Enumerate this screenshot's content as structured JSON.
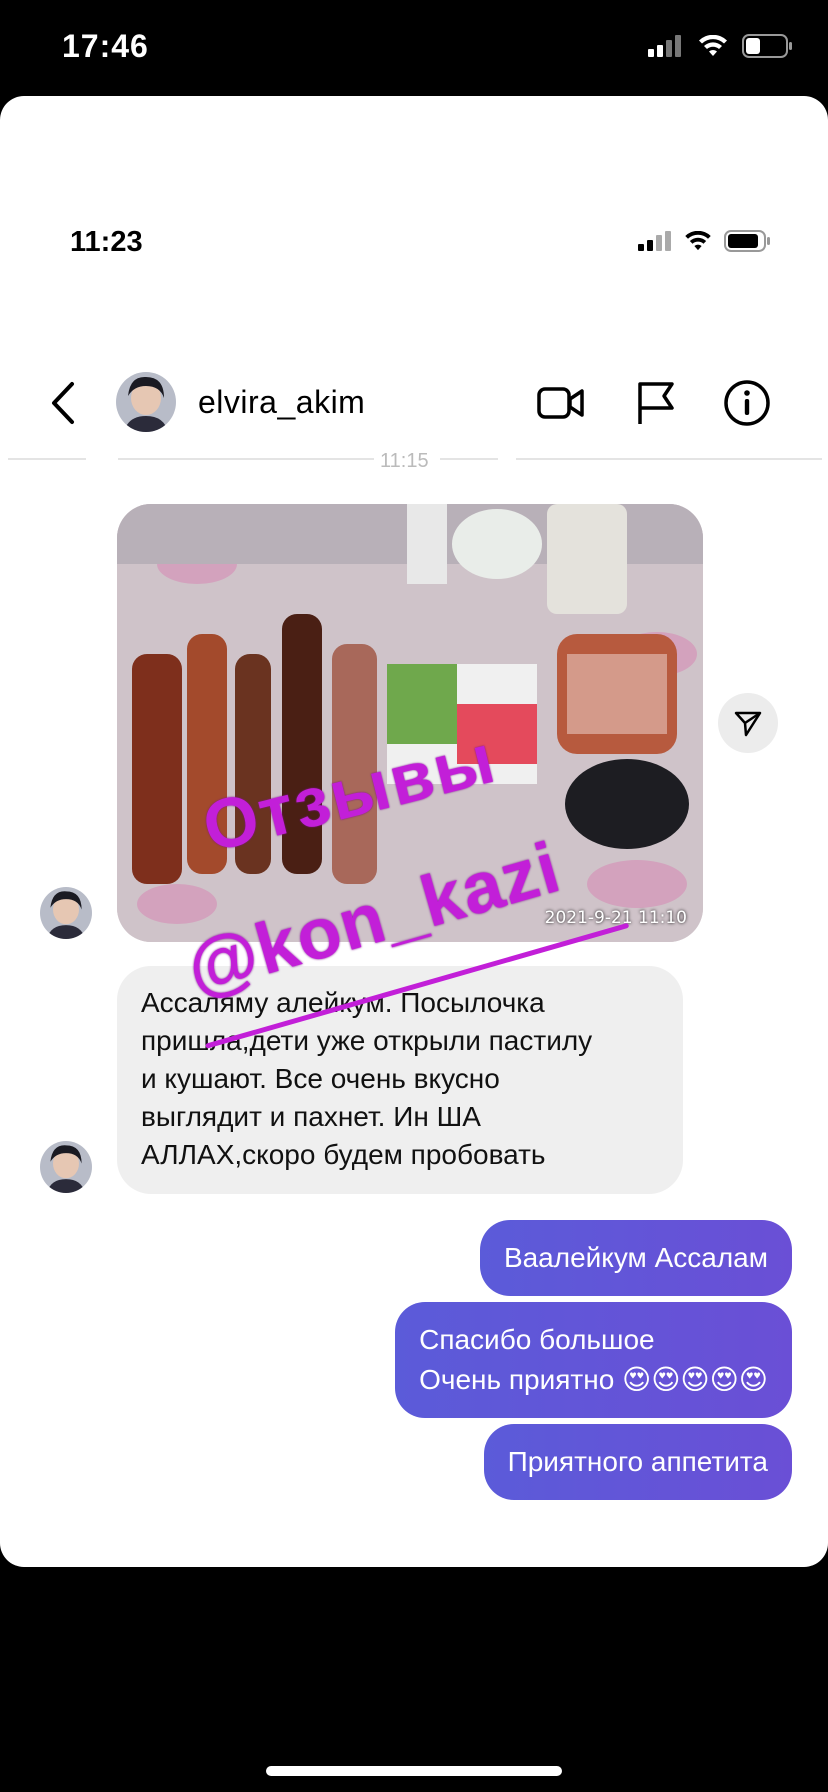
{
  "outer_status": {
    "time": "17:46"
  },
  "inner_status": {
    "time": "11:23"
  },
  "header": {
    "username": "elvira_akim"
  },
  "timestamp": "11:15",
  "photo": {
    "date_stamp": "2021-9-21 11:10"
  },
  "watermark": {
    "line1": "Отзывы",
    "line2": "@kon_kazi"
  },
  "incoming_message": {
    "lines": [
      "Ассаляму алейкум. Посылочка",
      "пришла,дети уже открыли пастилу",
      "и кушают. Все очень вкусно",
      "выглядит и пахнет. Ин ША",
      "АЛЛАХ,скоро будем пробовать"
    ]
  },
  "outgoing_messages": [
    {
      "text": "Ваалейкум Ассалам"
    },
    {
      "line1": "Спасибо большое",
      "line2": "Очень приятно 😍😍😍😍😍"
    },
    {
      "text": "Приятного аппетита"
    }
  ],
  "colors": {
    "bubble_out": "#5b5bd9",
    "bubble_in": "#efefef",
    "watermark": "#c21fd8"
  }
}
